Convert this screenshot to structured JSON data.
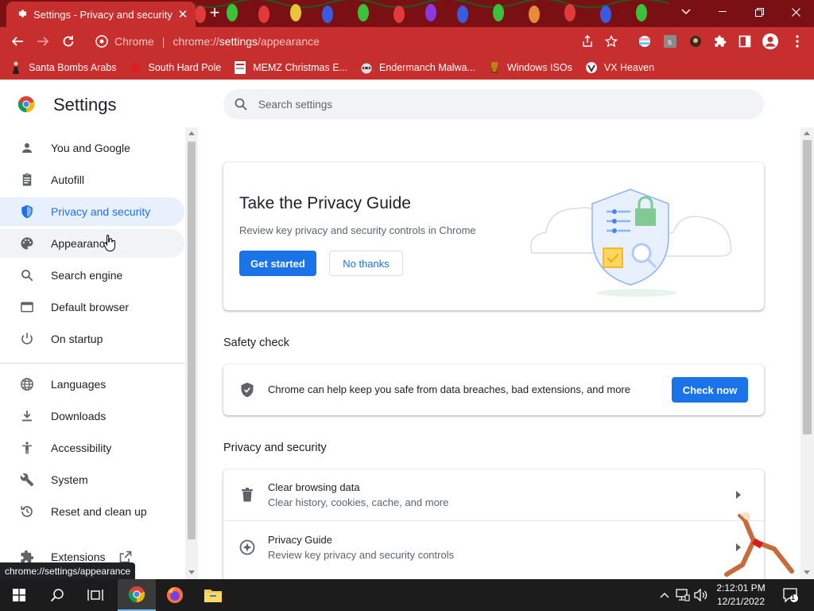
{
  "window": {
    "tab_title": "Settings - Privacy and security",
    "new_tab_symbol": "+"
  },
  "toolbar": {
    "omnibox_scheme": "Chrome",
    "omnibox_separator": "|",
    "omnibox_url_prefix": "chrome://",
    "omnibox_url_bold": "settings",
    "omnibox_url_suffix": "/appearance"
  },
  "bookmarks": [
    {
      "label": "Santa Bombs Arabs",
      "icon": "figure-icon"
    },
    {
      "label": "South Hard Pole",
      "icon": "snowflake-icon"
    },
    {
      "label": "MEMZ Christmas E...",
      "icon": "page-icon"
    },
    {
      "label": "Endermanch Malwa...",
      "icon": "raccoon-icon"
    },
    {
      "label": "Windows ISOs",
      "icon": "trophy-icon"
    },
    {
      "label": "VX Heaven",
      "icon": "vx-icon"
    }
  ],
  "settings": {
    "title": "Settings",
    "search_placeholder": "Search settings"
  },
  "sidebar": {
    "items": [
      {
        "label": "You and Google",
        "icon": "person-icon"
      },
      {
        "label": "Autofill",
        "icon": "clipboard-icon"
      },
      {
        "label": "Privacy and security",
        "icon": "shield-icon"
      },
      {
        "label": "Appearance",
        "icon": "palette-icon"
      },
      {
        "label": "Search engine",
        "icon": "search-icon"
      },
      {
        "label": "Default browser",
        "icon": "browser-icon"
      },
      {
        "label": "On startup",
        "icon": "power-icon"
      },
      {
        "label": "Languages",
        "icon": "globe-icon"
      },
      {
        "label": "Downloads",
        "icon": "download-icon"
      },
      {
        "label": "Accessibility",
        "icon": "accessibility-icon"
      },
      {
        "label": "System",
        "icon": "wrench-icon"
      },
      {
        "label": "Reset and clean up",
        "icon": "history-icon"
      },
      {
        "label": "Extensions",
        "icon": "puzzle-icon"
      }
    ],
    "active_item": "Privacy and security",
    "hovered_item": "Appearance"
  },
  "privacy_guide": {
    "title": "Take the Privacy Guide",
    "description": "Review key privacy and security controls in Chrome",
    "get_started_label": "Get started",
    "no_thanks_label": "No thanks"
  },
  "safety_check": {
    "section_title": "Safety check",
    "description": "Chrome can help keep you safe from data breaches, bad extensions, and more",
    "check_now_label": "Check now"
  },
  "privacy_section": {
    "section_title": "Privacy and security",
    "rows": [
      {
        "title": "Clear browsing data",
        "subtitle": "Clear history, cookies, cache, and more",
        "icon": "trash-icon"
      },
      {
        "title": "Privacy Guide",
        "subtitle": "Review key privacy and security controls",
        "icon": "compass-icon"
      }
    ]
  },
  "status_bar": {
    "url": "chrome://settings/appearance"
  },
  "taskbar": {
    "time": "2:12:01 PM",
    "date": "12/21/2022",
    "notification_count": "1"
  },
  "colors": {
    "accent": "#1a73e8",
    "frame": "#c62f2d",
    "frame_dark": "#7a1014",
    "active_nav_bg": "#e8f0fe"
  }
}
